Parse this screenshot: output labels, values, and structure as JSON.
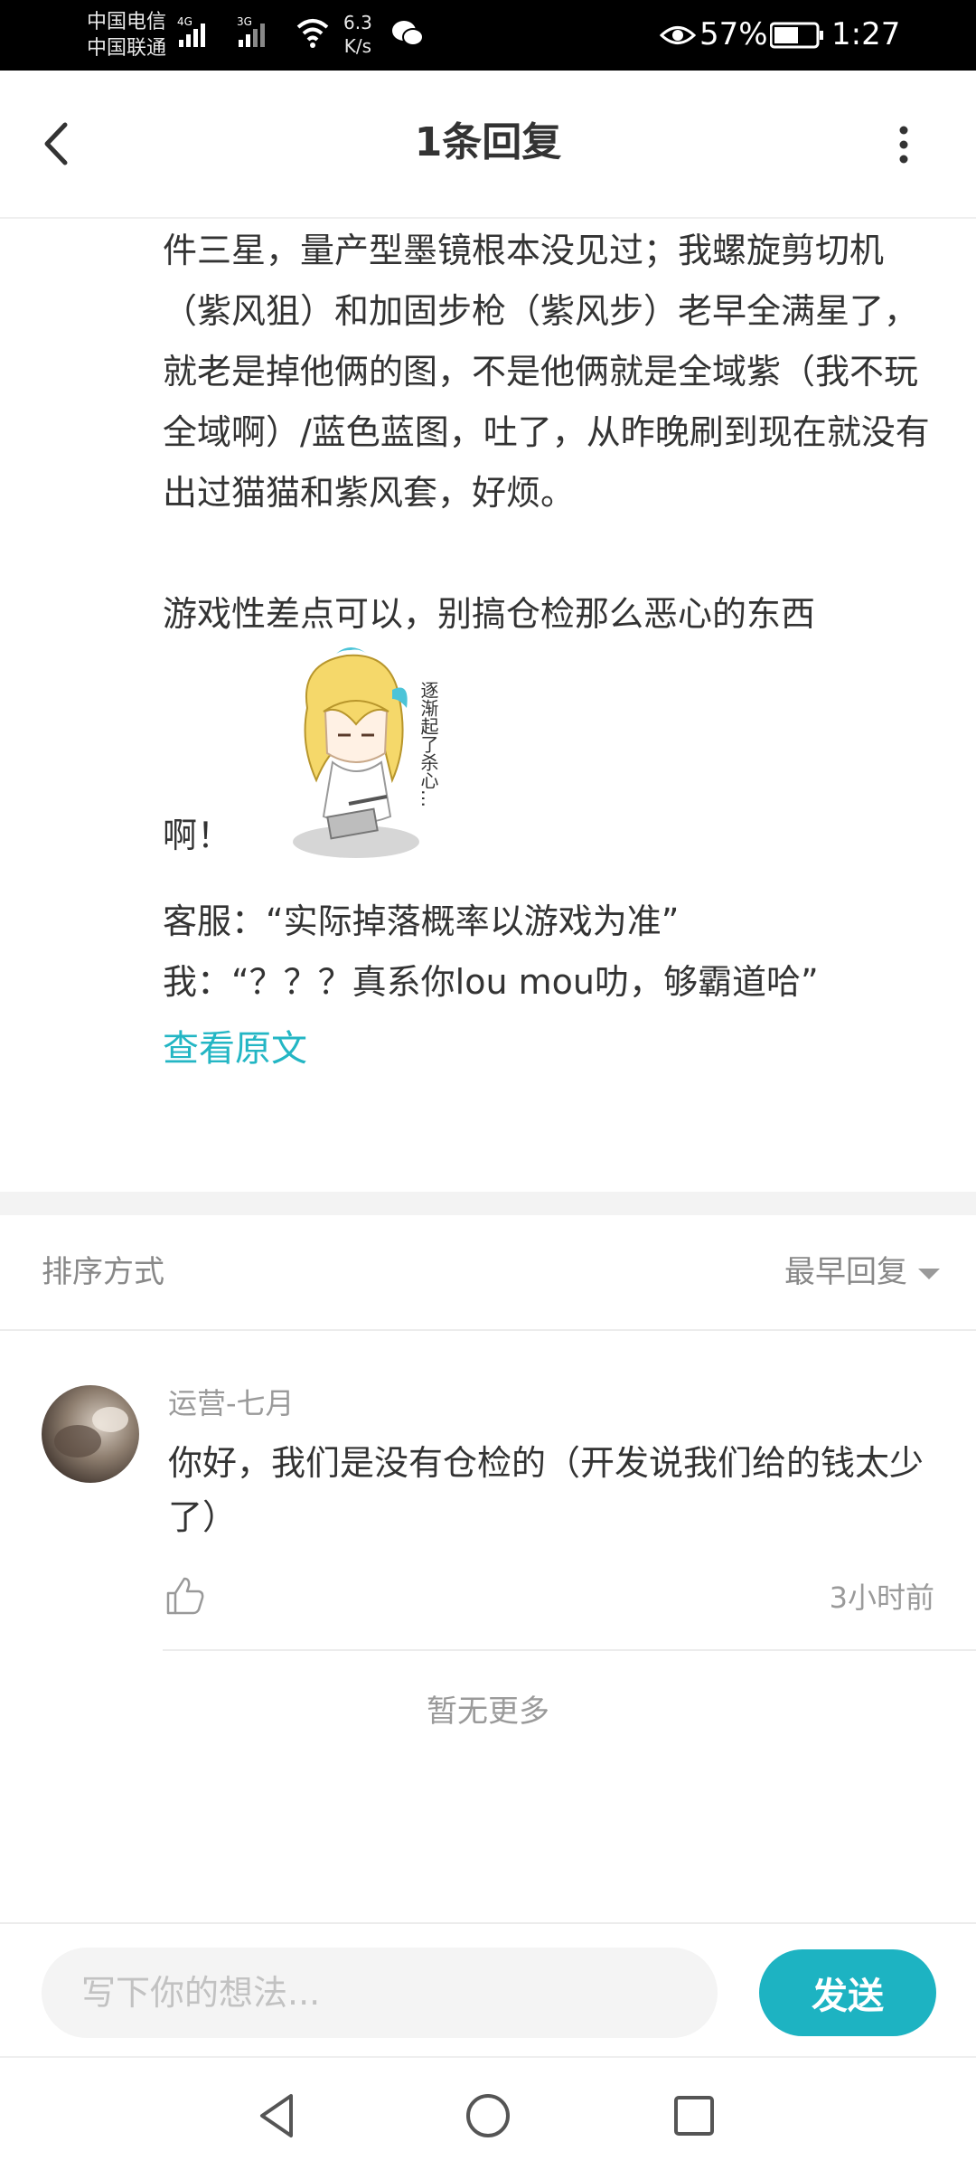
{
  "status_bar": {
    "carrier_1": "中国电信",
    "carrier_2": "中国联通",
    "network_1": "4G",
    "network_2": "3G",
    "speed_value": "6.3",
    "speed_unit": "K/s",
    "battery": "57%",
    "time": "1:27",
    "icons": [
      "signal-icon",
      "wifi-icon",
      "chat-icon",
      "eye-icon",
      "battery-icon"
    ]
  },
  "header": {
    "title": "1条回复",
    "back_icon": "back-arrow-icon",
    "more_icon": "more-vertical-icon"
  },
  "post": {
    "paragraph_1": "件三星，量产型墨镜根本没见过；我螺旋剪切机（紫风狙）和加固步枪（紫风步）老早全满星了，就老是掉他俩的图，不是他俩就是全域紫（我不玩全域啊）/蓝色蓝图，吐了，从昨晚刷到现在就没有出过猫猫和紫风套，好烦。",
    "paragraph_2": "游戏性差点可以，别搞仓检那么恶心的东西",
    "paragraph_3": "啊！",
    "sticker_text": "逐渐起了杀心…",
    "paragraph_4": "客服：“实际掉落概率以游戏为准”",
    "paragraph_5": "我：“？？？真系你lou mou叻，够霸道哈”",
    "view_original": "查看原文"
  },
  "sort": {
    "label": "排序方式",
    "selected": "最早回复"
  },
  "replies": [
    {
      "user": "运营-七月",
      "text": "你好，我们是没有仓检的（开发说我们给的钱太少了）",
      "time": "3小时前",
      "like_icon": "thumbs-up-icon"
    }
  ],
  "footer": {
    "no_more": "暂无更多"
  },
  "compose": {
    "placeholder": "写下你的想法...",
    "send_label": "发送"
  },
  "colors": {
    "accent": "#1db3c2",
    "link": "#23b6c4",
    "text": "#333333",
    "muted": "#9a9a9a"
  }
}
